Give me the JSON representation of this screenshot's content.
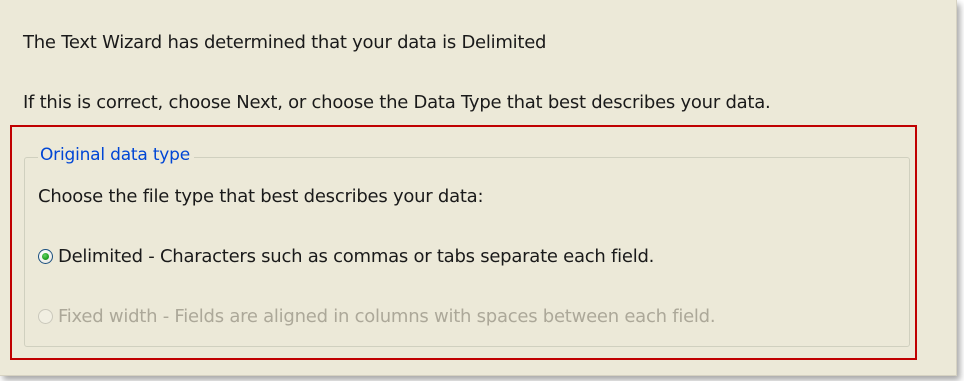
{
  "wizard": {
    "determined_text": "The Text Wizard has determined that your data is Delimited",
    "instruction_text": "If this is correct, choose Next, or choose the Data Type that best describes your data."
  },
  "group": {
    "legend": "Original data type",
    "prompt": "Choose the file type that best describes your data:",
    "options": [
      {
        "label": "Delimited - Characters such as commas or tabs separate each field.",
        "selected": true,
        "enabled": true
      },
      {
        "label": "Fixed width - Fields are aligned in columns with spaces between each field.",
        "selected": false,
        "enabled": false
      }
    ]
  },
  "colors": {
    "dialog_background": "#ece9d8",
    "legend_text": "#0046d5",
    "disabled_text": "#aca899",
    "highlight_outline": "#c00000",
    "radio_dot": "#21a121"
  }
}
